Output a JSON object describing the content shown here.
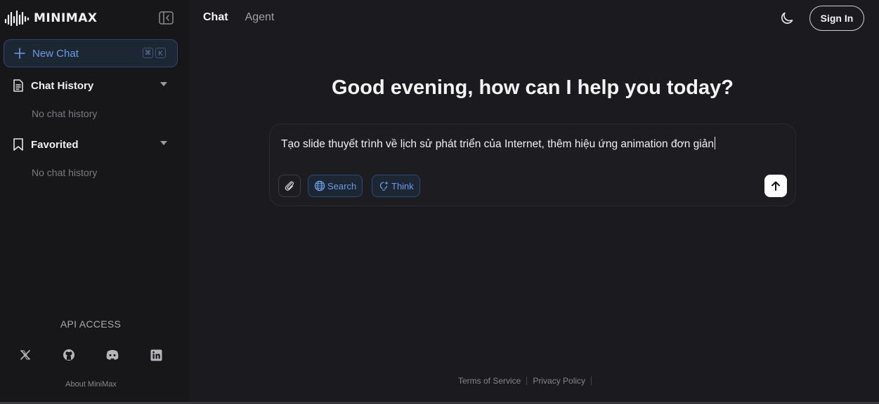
{
  "brand": {
    "name": "MINIMAX"
  },
  "sidebar": {
    "new_chat_label": "New Chat",
    "shortcut_keys": [
      "⌘",
      "K"
    ],
    "sections": [
      {
        "label": "Chat History",
        "empty_text": "No chat history"
      },
      {
        "label": "Favorited",
        "empty_text": "No chat history"
      }
    ],
    "api_access_label": "API ACCESS",
    "socials": [
      "x-icon",
      "github-icon",
      "discord-icon",
      "linkedin-icon"
    ],
    "about_label": "About MiniMax"
  },
  "header": {
    "tabs": [
      {
        "label": "Chat",
        "active": true
      },
      {
        "label": "Agent",
        "active": false
      }
    ],
    "signin_label": "Sign In"
  },
  "main": {
    "greeting": "Good evening, how can I help you today?",
    "prompt_value": "Tạo slide thuyết trình về lịch sử phát triển của Internet, thêm hiệu ứng animation đơn giản",
    "chips": [
      {
        "label": "Search",
        "icon": "globe-icon"
      },
      {
        "label": "Think",
        "icon": "sparkle-bulb-icon"
      }
    ]
  },
  "footer": {
    "links": [
      "Terms of Service",
      "Privacy Policy"
    ]
  },
  "colors": {
    "background": "#1b1b1f",
    "sidebar": "#17171a",
    "accent": "#6a9de6",
    "accent_border": "#2c4a74"
  }
}
